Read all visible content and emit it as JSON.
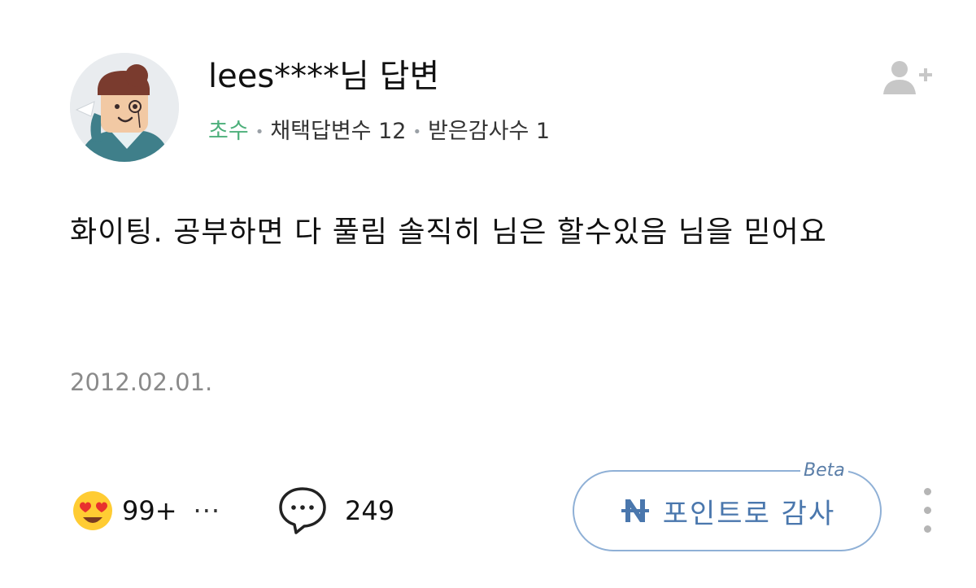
{
  "answer": {
    "author_name": "lees****님 답변",
    "author_level": "초수",
    "selected_answers_label": "채택답변수",
    "selected_answers_count": "12",
    "thanks_received_label": "받은감사수",
    "thanks_received_count": "1",
    "body": "화이팅. 공부하면 다 풀림 솔직히 님은 할수있음 님을 믿어요",
    "date": "2012.02.01."
  },
  "actions": {
    "reaction_count": "99+",
    "reaction_more": "···",
    "comment_count": "249",
    "thanks_button_label": "포인트로 감사",
    "thanks_badge": "Beta"
  },
  "colors": {
    "level_green": "#4caf7a",
    "thanks_blue": "#4a77ad",
    "thanks_border": "#8fb0d6",
    "date_gray": "#8a8a8a"
  },
  "icons": {
    "avatar": "character-avatar",
    "follow": "add-user-icon",
    "reaction": "heart-eyes-emoji-icon",
    "comment": "speech-bubble-icon",
    "point": "naver-point-icon",
    "more": "vertical-dots-icon"
  }
}
